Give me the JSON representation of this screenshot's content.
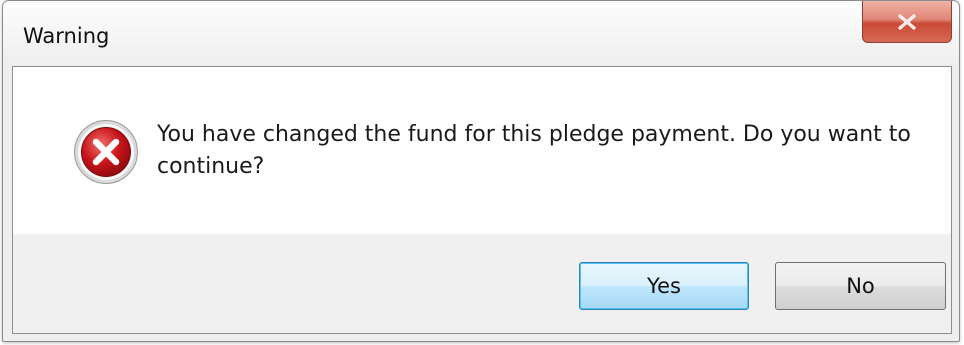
{
  "dialog": {
    "title": "Warning",
    "close_label": "X",
    "message": "You have changed the fund for this pledge payment. Do you want to continue?",
    "icon": "error-icon"
  },
  "buttons": {
    "yes_label": "Yes",
    "no_label": "No"
  },
  "colors": {
    "close_button": "#c94a36",
    "error_icon": "#c8141a",
    "default_button_border": "#3c7fb1"
  }
}
